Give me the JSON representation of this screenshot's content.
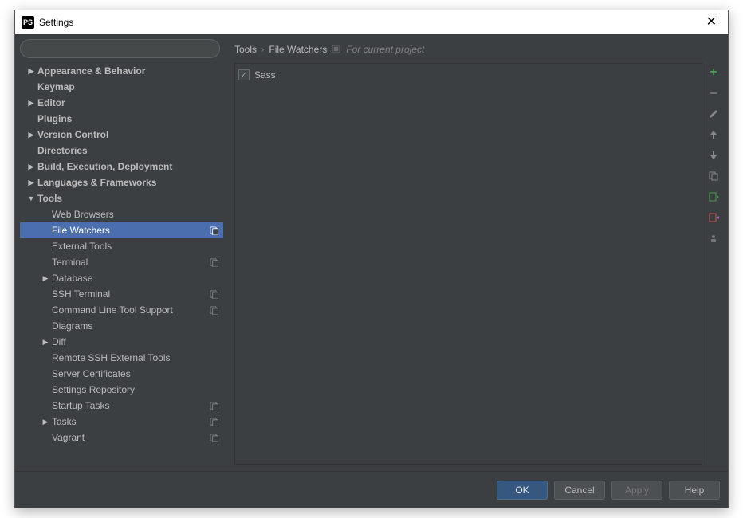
{
  "window": {
    "title": "Settings",
    "app_icon_text": "PS"
  },
  "search": {
    "placeholder": ""
  },
  "tree": [
    {
      "label": "Appearance & Behavior",
      "level": 1,
      "arrow": "▶",
      "bold": true
    },
    {
      "label": "Keymap",
      "level": 1,
      "bold": true
    },
    {
      "label": "Editor",
      "level": 1,
      "arrow": "▶",
      "bold": true
    },
    {
      "label": "Plugins",
      "level": 1,
      "bold": true
    },
    {
      "label": "Version Control",
      "level": 1,
      "arrow": "▶",
      "bold": true
    },
    {
      "label": "Directories",
      "level": 1,
      "bold": true
    },
    {
      "label": "Build, Execution, Deployment",
      "level": 1,
      "arrow": "▶",
      "bold": true
    },
    {
      "label": "Languages & Frameworks",
      "level": 1,
      "arrow": "▶",
      "bold": true
    },
    {
      "label": "Tools",
      "level": 1,
      "arrow": "▼",
      "bold": true
    },
    {
      "label": "Web Browsers",
      "level": 2
    },
    {
      "label": "File Watchers",
      "level": 2,
      "selected": true,
      "proj": true
    },
    {
      "label": "External Tools",
      "level": 2
    },
    {
      "label": "Terminal",
      "level": 2,
      "proj": true
    },
    {
      "label": "Database",
      "level": 2,
      "arrow": "▶"
    },
    {
      "label": "SSH Terminal",
      "level": 2,
      "proj": true
    },
    {
      "label": "Command Line Tool Support",
      "level": 2,
      "proj": true
    },
    {
      "label": "Diagrams",
      "level": 2
    },
    {
      "label": "Diff",
      "level": 2,
      "arrow": "▶"
    },
    {
      "label": "Remote SSH External Tools",
      "level": 2
    },
    {
      "label": "Server Certificates",
      "level": 2
    },
    {
      "label": "Settings Repository",
      "level": 2
    },
    {
      "label": "Startup Tasks",
      "level": 2,
      "proj": true
    },
    {
      "label": "Tasks",
      "level": 2,
      "arrow": "▶",
      "proj": true
    },
    {
      "label": "Vagrant",
      "level": 2,
      "proj": true
    }
  ],
  "breadcrumb": {
    "root": "Tools",
    "leaf": "File Watchers",
    "scope": "For current project"
  },
  "watchers": [
    {
      "name": "Sass",
      "enabled": true
    }
  ],
  "buttons": {
    "ok": "OK",
    "cancel": "Cancel",
    "apply": "Apply",
    "help": "Help"
  }
}
